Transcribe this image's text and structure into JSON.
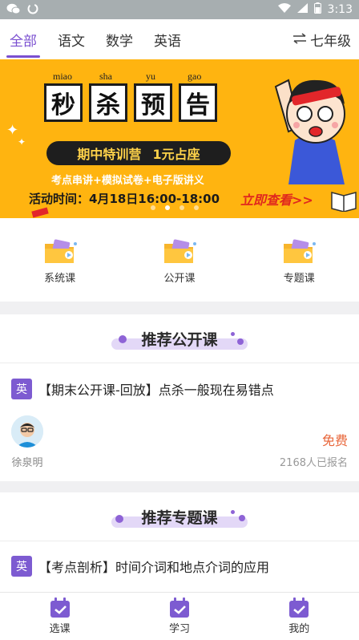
{
  "status_bar": {
    "time": "3:13",
    "battery": "64"
  },
  "top_nav": {
    "tabs": [
      {
        "label": "全部",
        "active": true
      },
      {
        "label": "语文",
        "active": false
      },
      {
        "label": "数学",
        "active": false
      },
      {
        "label": "英语",
        "active": false
      }
    ],
    "grade": "七年级"
  },
  "banner": {
    "pinyin": [
      "miao",
      "sha",
      "yu",
      "gao"
    ],
    "tiles": [
      "秒",
      "杀",
      "预",
      "告"
    ],
    "pill_left": "期中特训营",
    "pill_right": "1元占座",
    "line1": "考点串讲+模拟试卷+电子版讲义",
    "line2": "活动时间：4月18日16:00-18:00",
    "cta": "立即查看>>",
    "slide_count": 4,
    "active_slide": 1
  },
  "categories": [
    {
      "label": "系统课",
      "icon": "folder-video-icon"
    },
    {
      "label": "公开课",
      "icon": "folder-video-icon"
    },
    {
      "label": "专题课",
      "icon": "folder-video-icon"
    }
  ],
  "public_section": {
    "title": "推荐公开课",
    "course": {
      "subject": "英",
      "title": "【期末公开课-回放】点杀一般现在易错点",
      "teacher": "徐泉明",
      "price": "免费",
      "signups": "2168人已报名"
    }
  },
  "topic_section": {
    "title": "推荐专题课",
    "course": {
      "subject": "英",
      "title": "【考点剖析】时间介词和地点介词的应用"
    }
  },
  "bottom_nav": [
    {
      "label": "选课",
      "icon": "calendar-check-icon"
    },
    {
      "label": "学习",
      "icon": "calendar-check-icon"
    },
    {
      "label": "我的",
      "icon": "calendar-check-icon"
    }
  ],
  "colors": {
    "accent": "#7a4fd0",
    "banner": "#ffb410",
    "price": "#e8663a"
  }
}
